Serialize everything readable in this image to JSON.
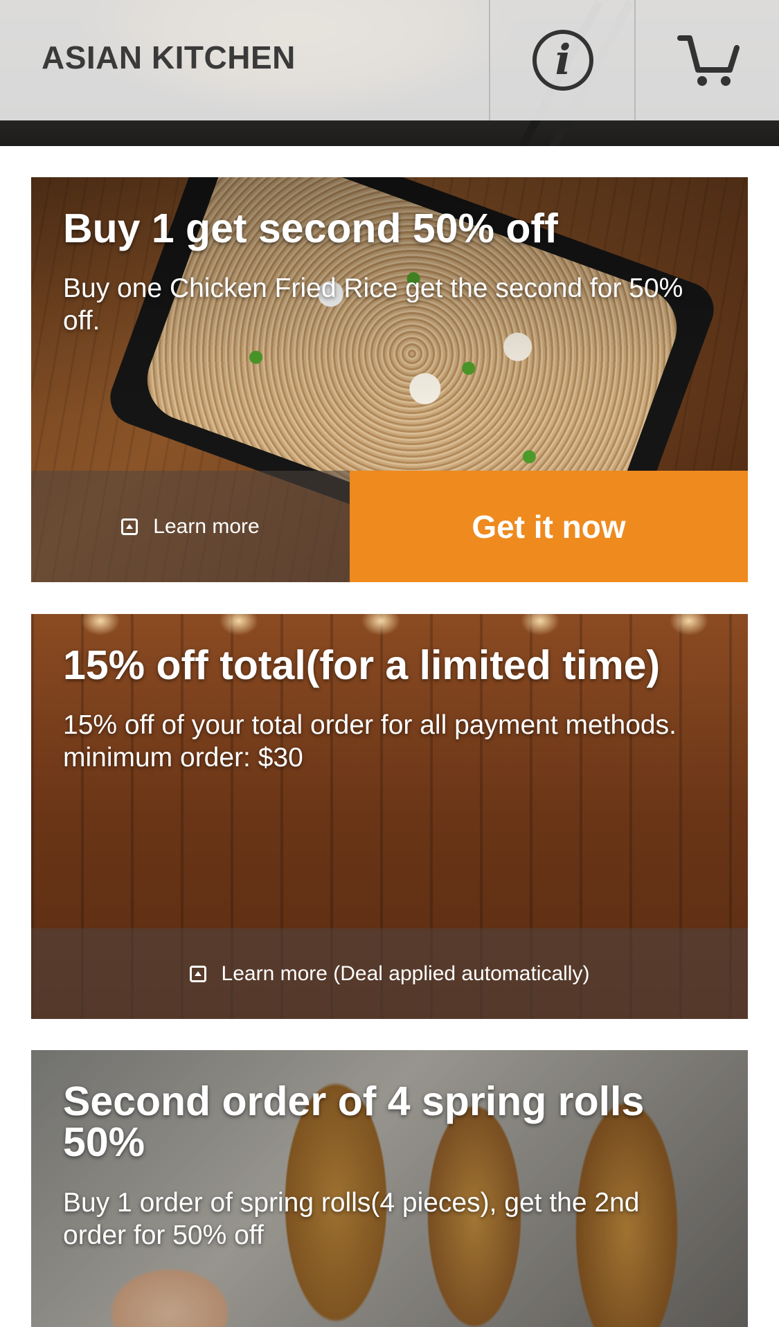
{
  "header": {
    "brand": "ASIAN KITCHEN",
    "info_icon": "info-icon",
    "cart_icon": "cart-icon"
  },
  "deals": [
    {
      "title": "Buy 1 get second 50% off",
      "description": "Buy one Chicken Fried Rice get the second for 50% off.",
      "learn_more": "Learn more",
      "cta": "Get it now"
    },
    {
      "title": "15% off total(for a limited time)",
      "description": "15% off of your total order for all payment methods. minimum order: $30",
      "learn_more": "Learn more (Deal applied automatically)"
    },
    {
      "title": "Second order of 4 spring rolls 50%",
      "description": "Buy 1 order of spring rolls(4 pieces), get the 2nd order for 50% off"
    }
  ],
  "colors": {
    "accent": "#ee8a1e",
    "header_bar": "#ececec",
    "brand_text": "#3a3a3a"
  }
}
